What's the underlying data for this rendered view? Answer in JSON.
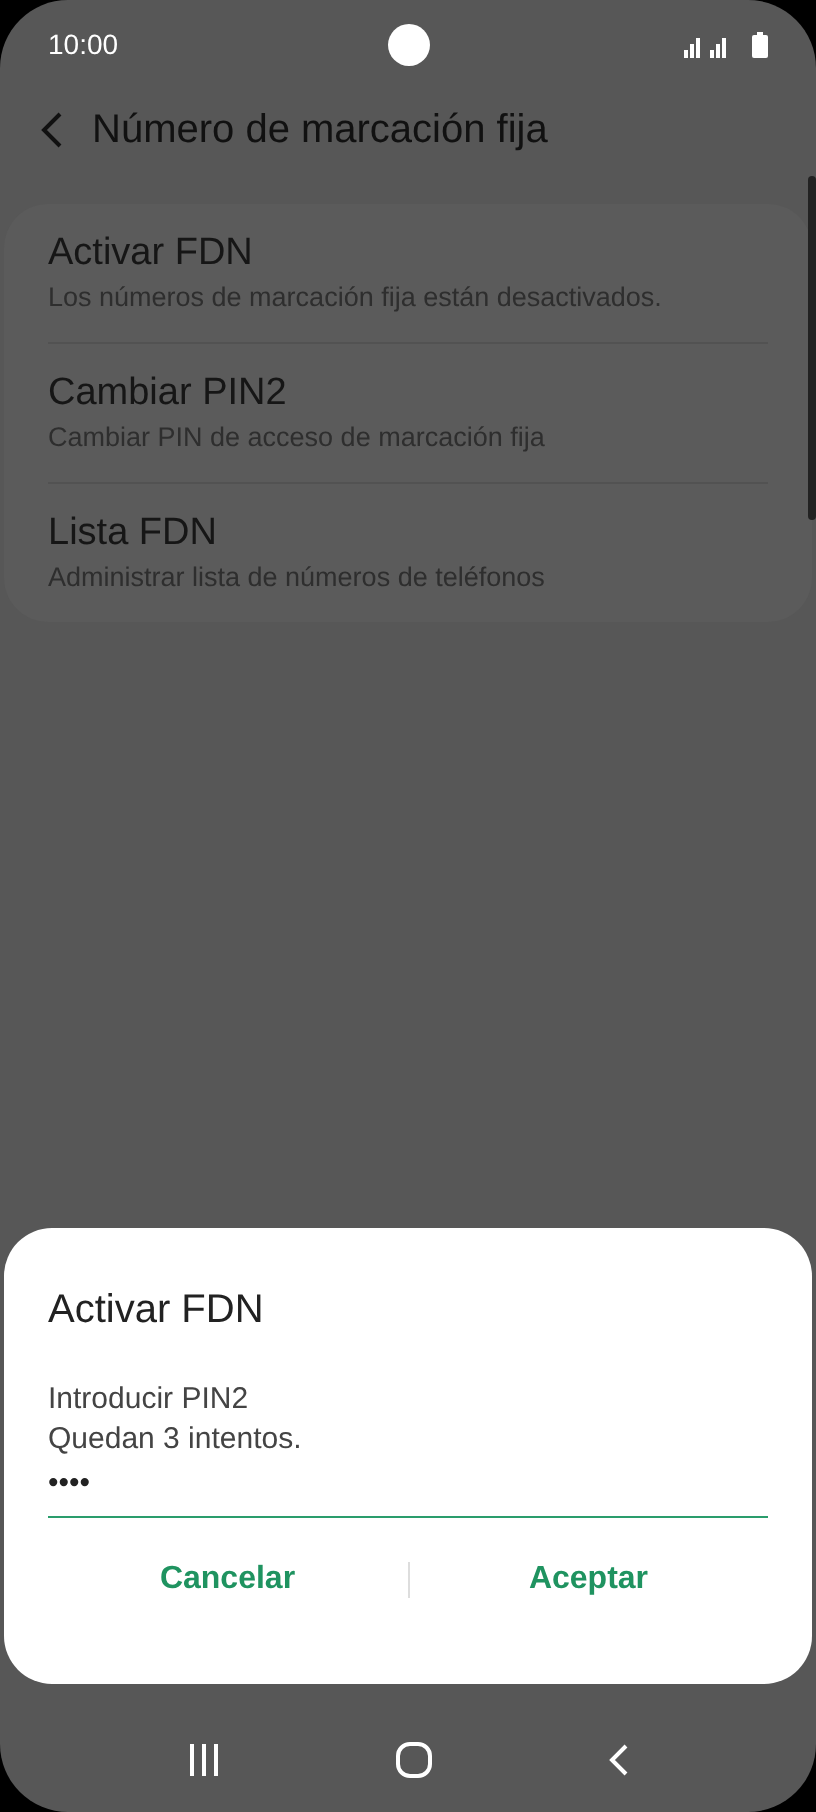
{
  "status_bar": {
    "time": "10:00"
  },
  "header": {
    "title": "Número de marcación fija"
  },
  "items": [
    {
      "title": "Activar FDN",
      "subtitle": "Los números de marcación fija están desactivados."
    },
    {
      "title": "Cambiar PIN2",
      "subtitle": "Cambiar PIN de acceso de marcación fija"
    },
    {
      "title": "Lista FDN",
      "subtitle": "Administrar lista de números de teléfonos"
    }
  ],
  "dialog": {
    "title": "Activar FDN",
    "message": "Introducir PIN2",
    "hint": "Quedan 3 intentos.",
    "value": "••••",
    "buttons": [
      "Cancelar",
      "Aceptar"
    ]
  }
}
